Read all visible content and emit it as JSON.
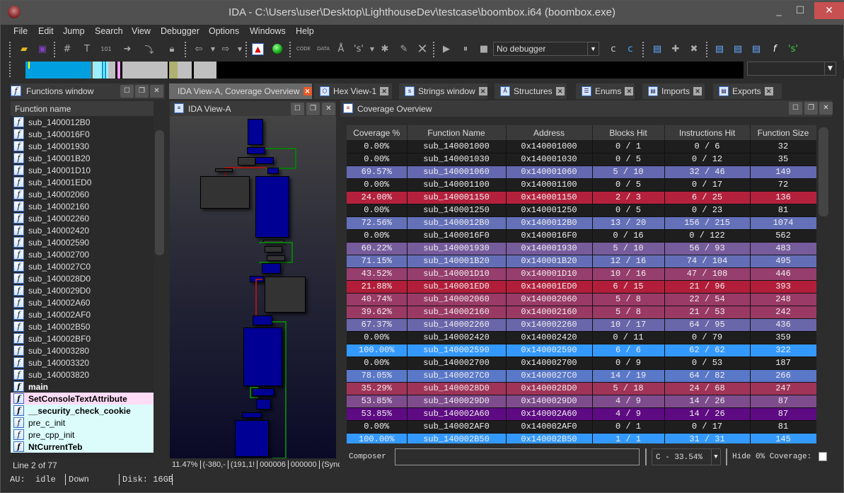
{
  "window": {
    "title": "IDA - C:\\Users\\user\\Desktop\\LighthouseDev\\testcase\\boombox.i64 (boombox.exe)",
    "minimize": "_",
    "maximize": "☐",
    "close": "✕"
  },
  "menu": [
    "File",
    "Edit",
    "Jump",
    "Search",
    "View",
    "Debugger",
    "Options",
    "Windows",
    "Help"
  ],
  "toolbar": {
    "debugger_select": "No debugger",
    "icons": [
      "open-icon",
      "save-icon",
      "search-hex-icon",
      "search-text-icon",
      "search-binary-icon",
      "search-next-icon",
      "jump-icon",
      "lock-icon",
      "back-icon",
      "forward-icon",
      "warning-icon",
      "green-dot-icon",
      "code-icon",
      "data-icon",
      "struct-icon",
      "string-icon",
      "array-icon",
      "rename-icon",
      "undefine-icon",
      "play-icon",
      "pause-icon",
      "stop-icon"
    ]
  },
  "functions_window": {
    "title": "Functions window",
    "column": "Function name",
    "items": [
      {
        "name": "sub_1400012B0",
        "style": "normal"
      },
      {
        "name": "sub_1400016F0",
        "style": "normal"
      },
      {
        "name": "sub_140001930",
        "style": "normal"
      },
      {
        "name": "sub_140001B20",
        "style": "normal"
      },
      {
        "name": "sub_140001D10",
        "style": "normal"
      },
      {
        "name": "sub_140001ED0",
        "style": "normal"
      },
      {
        "name": "sub_140002060",
        "style": "normal"
      },
      {
        "name": "sub_140002160",
        "style": "normal"
      },
      {
        "name": "sub_140002260",
        "style": "normal"
      },
      {
        "name": "sub_140002420",
        "style": "normal"
      },
      {
        "name": "sub_140002590",
        "style": "normal"
      },
      {
        "name": "sub_140002700",
        "style": "normal"
      },
      {
        "name": "sub_1400027C0",
        "style": "normal"
      },
      {
        "name": "sub_1400028D0",
        "style": "normal"
      },
      {
        "name": "sub_1400029D0",
        "style": "normal"
      },
      {
        "name": "sub_140002A60",
        "style": "normal"
      },
      {
        "name": "sub_140002AF0",
        "style": "normal"
      },
      {
        "name": "sub_140002B50",
        "style": "normal"
      },
      {
        "name": "sub_140002BF0",
        "style": "normal"
      },
      {
        "name": "sub_140003280",
        "style": "normal"
      },
      {
        "name": "sub_140003320",
        "style": "normal"
      },
      {
        "name": "sub_140003820",
        "style": "normal"
      },
      {
        "name": "main",
        "style": "bold"
      },
      {
        "name": "SetConsoleTextAttribute",
        "style": "import"
      },
      {
        "name": "__security_check_cookie",
        "style": "lib-bold"
      },
      {
        "name": "pre_c_init",
        "style": "lib"
      },
      {
        "name": "pre_cpp_init",
        "style": "lib"
      },
      {
        "name": "NtCurrentTeb",
        "style": "lib-bold"
      }
    ],
    "status": "Line 2 of 77"
  },
  "tabs": [
    {
      "label": "IDA View-A, Coverage Overview",
      "active": true
    },
    {
      "label": "Hex View-1"
    },
    {
      "label": "Strings window"
    },
    {
      "label": "Structures"
    },
    {
      "label": "Enums"
    },
    {
      "label": "Imports"
    },
    {
      "label": "Exports"
    }
  ],
  "ida_view": {
    "title": "IDA View-A",
    "status": [
      "11.47%",
      "(-380,-",
      "(191,1!",
      "000006",
      "000000",
      "(Synchr"
    ]
  },
  "coverage": {
    "title": "Coverage Overview",
    "columns": [
      "Coverage %",
      "Function Name",
      "Address",
      "Blocks Hit",
      "Instructions Hit",
      "Function Size"
    ],
    "rows": [
      [
        "0.00%",
        "sub_140001000",
        "0x140001000",
        "0 / 1",
        "0 / 6",
        "32",
        "#1e1e1e"
      ],
      [
        "0.00%",
        "sub_140001030",
        "0x140001030",
        "0 / 5",
        "0 / 12",
        "35",
        "#1e1e1e"
      ],
      [
        "69.57%",
        "sub_140001060",
        "0x140001060",
        "5 / 10",
        "32 / 46",
        "149",
        "#6468b0"
      ],
      [
        "0.00%",
        "sub_140001100",
        "0x140001100",
        "0 / 5",
        "0 / 17",
        "72",
        "#1e1e1e"
      ],
      [
        "24.00%",
        "sub_140001150",
        "0x140001150",
        "2 / 3",
        "6 / 25",
        "136",
        "#b4213d"
      ],
      [
        "0.00%",
        "sub_140001250",
        "0x140001250",
        "0 / 5",
        "0 / 23",
        "81",
        "#1e1e1e"
      ],
      [
        "72.56%",
        "sub_1400012B0",
        "0x1400012B0",
        "13 / 20",
        "156 / 215",
        "1074",
        "#6470b8"
      ],
      [
        "0.00%",
        "sub_1400016F0",
        "0x1400016F0",
        "0 / 16",
        "0 / 122",
        "562",
        "#1e1e1e"
      ],
      [
        "60.22%",
        "sub_140001930",
        "0x140001930",
        "5 / 10",
        "56 / 93",
        "483",
        "#775c9c"
      ],
      [
        "71.15%",
        "sub_140001B20",
        "0x140001B20",
        "12 / 16",
        "74 / 104",
        "495",
        "#646eb6"
      ],
      [
        "43.52%",
        "sub_140001D10",
        "0x140001D10",
        "10 / 16",
        "47 / 108",
        "446",
        "#963e6e"
      ],
      [
        "21.88%",
        "sub_140001ED0",
        "0x140001ED0",
        "6 / 15",
        "21 / 96",
        "393",
        "#b21e3a"
      ],
      [
        "40.74%",
        "sub_140002060",
        "0x140002060",
        "5 / 8",
        "22 / 54",
        "248",
        "#9a3a66"
      ],
      [
        "39.62%",
        "sub_140002160",
        "0x140002160",
        "5 / 8",
        "21 / 53",
        "242",
        "#9a3a64"
      ],
      [
        "67.37%",
        "sub_140002260",
        "0x140002260",
        "10 / 17",
        "64 / 95",
        "436",
        "#6a66aa"
      ],
      [
        "0.00%",
        "sub_140002420",
        "0x140002420",
        "0 / 11",
        "0 / 79",
        "359",
        "#1e1e1e"
      ],
      [
        "100.00%",
        "sub_140002590",
        "0x140002590",
        "6 / 6",
        "62 / 62",
        "322",
        "#3399ff"
      ],
      [
        "0.00%",
        "sub_140002700",
        "0x140002700",
        "0 / 9",
        "0 / 53",
        "187",
        "#1e1e1e"
      ],
      [
        "78.05%",
        "sub_1400027C0",
        "0x1400027C0",
        "14 / 19",
        "64 / 82",
        "266",
        "#5a78c8"
      ],
      [
        "35.29%",
        "sub_1400028D0",
        "0x1400028D0",
        "5 / 18",
        "24 / 68",
        "247",
        "#a03458"
      ],
      [
        "53.85%",
        "sub_1400029D0",
        "0x1400029D0",
        "4 / 9",
        "14 / 26",
        "87",
        "#7e4c8c"
      ],
      [
        "53.85%",
        "sub_140002A60",
        "0x140002A60",
        "4 / 9",
        "14 / 26",
        "87",
        "#5e0a82"
      ],
      [
        "0.00%",
        "sub_140002AF0",
        "0x140002AF0",
        "0 / 1",
        "0 / 17",
        "81",
        "#1e1e1e"
      ],
      [
        "100.00%",
        "sub_140002B50",
        "0x140002B50",
        "1 / 1",
        "31 / 31",
        "145",
        "#3399ff"
      ]
    ],
    "composer_label": "Composer",
    "composer_value": "",
    "aggregate": "C - 33.54%",
    "hide_zero_label": "Hide 0% Coverage:"
  },
  "statusbar": {
    "au": "AU:  idle",
    "direction": "Down",
    "disk": "Disk: 16GB"
  }
}
